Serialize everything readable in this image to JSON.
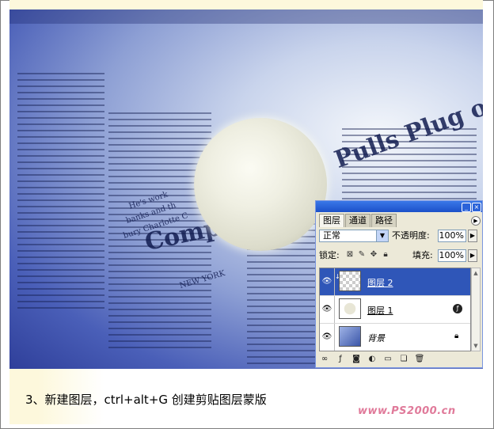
{
  "caption": "3、新建图层，ctrl+alt+G 创建剪贴图层蒙版",
  "watermark": "www.PS2000.cn",
  "background_text": {
    "headline_right": "Pulls Plug on",
    "headline_left": "Comp",
    "small_lines": [
      "He's work",
      "banks and th",
      "bury Charlotte C",
      "NEW YORK"
    ]
  },
  "panel": {
    "tabs": [
      {
        "label": "图层",
        "active": true
      },
      {
        "label": "通道",
        "active": false
      },
      {
        "label": "路径",
        "active": false
      }
    ],
    "blend_mode": "正常",
    "opacity_label": "不透明度:",
    "opacity_value": "100%",
    "lock_label": "锁定:",
    "fill_label": "填充:",
    "fill_value": "100%",
    "layers": [
      {
        "name": "图层 2",
        "selected": true,
        "thumb": "transparent",
        "clipped": true
      },
      {
        "name": "图层 1",
        "selected": false,
        "thumb": "sphere",
        "has_fx": true
      },
      {
        "name": "背景",
        "selected": false,
        "thumb": "background",
        "locked": true
      }
    ],
    "bottom_icons": [
      "link-icon",
      "fx-icon",
      "mask-icon",
      "adjustment-icon",
      "folder-icon",
      "new-layer-icon",
      "trash-icon"
    ]
  },
  "colors": {
    "selection": "#2f56b8",
    "titlebar": "#1b50c9",
    "panel_bg": "#ece9d8",
    "watermark": "#e07a9a"
  }
}
